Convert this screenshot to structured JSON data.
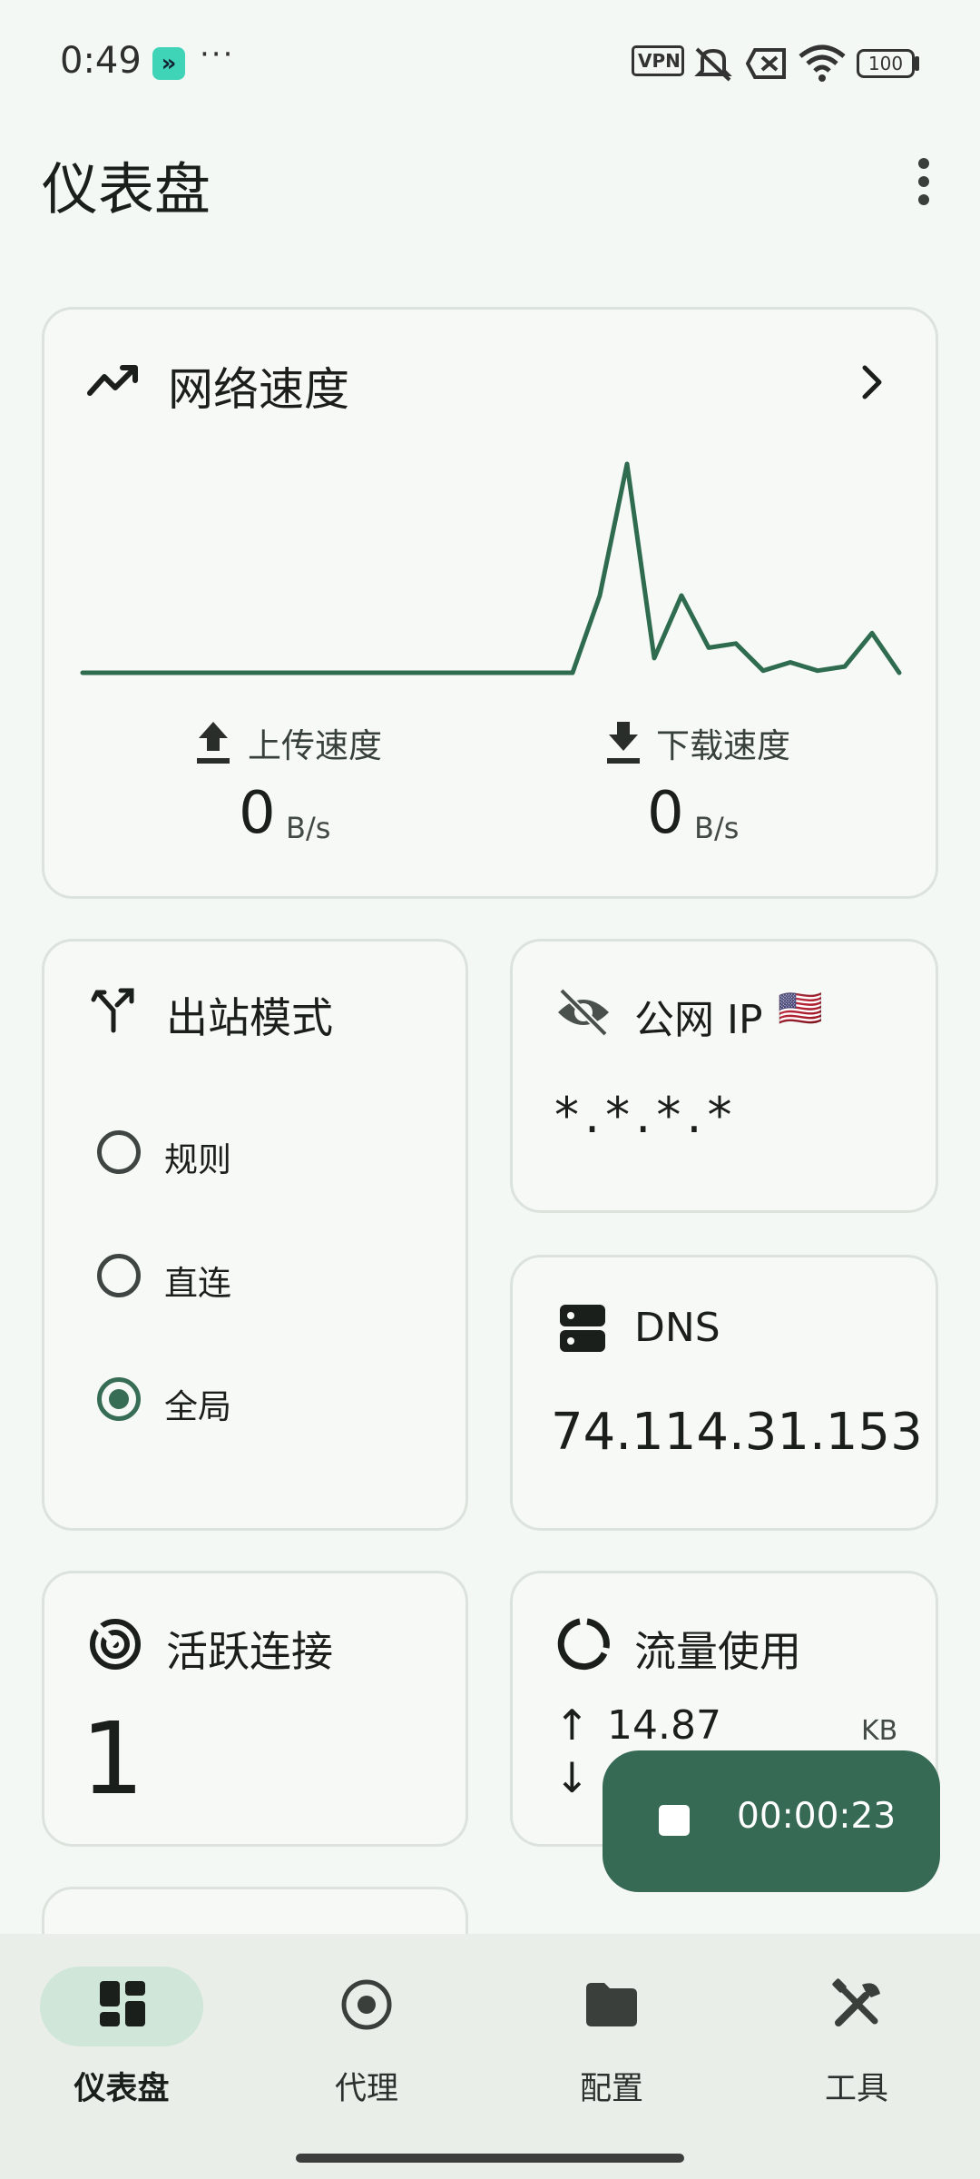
{
  "status_bar": {
    "time": "0:49",
    "app_icon_glyph": "»",
    "more_dots": "···",
    "vpn_badge": "VPN",
    "battery": "100"
  },
  "header": {
    "title": "仪表盘"
  },
  "speed_card": {
    "title": "网络速度",
    "upload_label": "上传速度",
    "upload_value": "0",
    "upload_unit": "B/s",
    "download_label": "下载速度",
    "download_value": "0",
    "download_unit": "B/s"
  },
  "chart_data": {
    "type": "line",
    "series": [
      {
        "values": [
          0,
          0,
          0,
          0,
          0,
          0,
          0,
          0,
          0,
          0,
          0,
          0,
          0,
          0,
          0,
          0,
          0,
          0,
          0,
          0.37,
          1.0,
          0.07,
          0.37,
          0.12,
          0.14,
          0.01,
          0.05,
          0.01,
          0.03,
          0.19,
          0
        ]
      }
    ],
    "color": "#2e6b4f"
  },
  "outbound_card": {
    "title": "出站模式",
    "options": [
      {
        "label": "规则",
        "checked": false
      },
      {
        "label": "直连",
        "checked": false
      },
      {
        "label": "全局",
        "checked": true
      }
    ]
  },
  "public_ip_card": {
    "title": "公网 IP",
    "flag": "🇺🇸",
    "value": "*.*.*.*"
  },
  "dns_card": {
    "title": "DNS",
    "value": "74.114.31.153"
  },
  "active_conn_card": {
    "title": "活跃连接",
    "value": "1"
  },
  "traffic_card": {
    "title": "流量使用",
    "up_arrow": "↑",
    "up_value": "14.87",
    "up_unit": "KB",
    "down_arrow": "↓"
  },
  "fab": {
    "timer": "00:00:23"
  },
  "bottom_nav": {
    "items": [
      {
        "label": "仪表盘",
        "icon": "dashboard-icon",
        "active": true
      },
      {
        "label": "代理",
        "icon": "proxy-icon",
        "active": false
      },
      {
        "label": "配置",
        "icon": "folder-icon",
        "active": false
      },
      {
        "label": "工具",
        "icon": "tools-icon",
        "active": false
      }
    ]
  },
  "colors": {
    "accent": "#366a55",
    "background": "#f4f8f4"
  }
}
